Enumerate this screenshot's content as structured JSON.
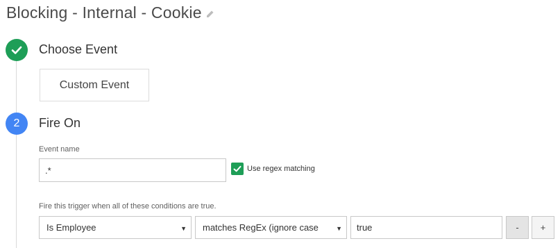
{
  "title": "Blocking - Internal - Cookie",
  "steps": [
    {
      "number": "",
      "label": "Choose Event",
      "status": "complete"
    },
    {
      "number": "2",
      "label": "Fire On",
      "status": "active"
    }
  ],
  "event_choice": {
    "label": "Custom Event"
  },
  "event_name": {
    "label": "Event name",
    "value": ".*",
    "regex_label": "Use regex matching",
    "regex_checked": true
  },
  "conditions": {
    "label": "Fire this trigger when all of these conditions are true.",
    "rows": [
      {
        "variable": "Is Employee",
        "operator": "matches RegEx (ignore case",
        "value": "true"
      }
    ],
    "remove_label": "-",
    "add_label": "+"
  },
  "colors": {
    "complete": "#1e9e57",
    "active": "#4285f4"
  }
}
